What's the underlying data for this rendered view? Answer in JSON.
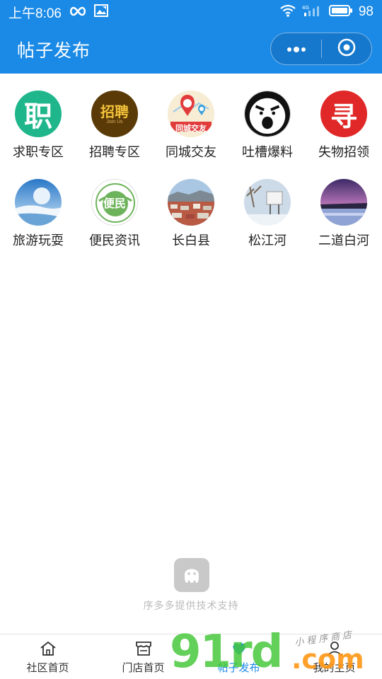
{
  "status_bar": {
    "time": "上午8:06",
    "battery": "98",
    "icons": [
      "infinity-icon",
      "image-notification-icon",
      "wifi-icon",
      "signal-4g-icon",
      "battery-icon"
    ]
  },
  "header": {
    "title": "帖子发布",
    "capsule_icons": [
      "more-dots-icon",
      "close-target-icon"
    ]
  },
  "colors": {
    "header_bg": "#1a8ae6",
    "accent": "#1a8ae6"
  },
  "categories": [
    {
      "label": "求职专区",
      "icon": "job-seek-icon",
      "glyph": "职"
    },
    {
      "label": "招聘专区",
      "icon": "recruit-icon",
      "glyph": "招聘",
      "sub": "Join Us"
    },
    {
      "label": "同城交友",
      "icon": "city-friends-icon",
      "glyph": "同城交友"
    },
    {
      "label": "吐槽爆料",
      "icon": "complain-face-icon"
    },
    {
      "label": "失物招领",
      "icon": "lost-found-icon",
      "glyph": "寻"
    },
    {
      "label": "旅游玩耍",
      "icon": "travel-photo-icon"
    },
    {
      "label": "便民资讯",
      "icon": "convenience-info-icon",
      "glyph": "便民"
    },
    {
      "label": "长白县",
      "icon": "changbai-county-photo-icon"
    },
    {
      "label": "松江河",
      "icon": "songjianghe-photo-icon"
    },
    {
      "label": "二道白河",
      "icon": "erdaobaihe-photo-icon"
    }
  ],
  "support": {
    "text": "序多多提供技术支持",
    "icon": "octopus-logo-icon"
  },
  "tabs": [
    {
      "label": "社区首页",
      "icon": "home-icon"
    },
    {
      "label": "门店首页",
      "icon": "store-icon"
    },
    {
      "label": "帖子发布",
      "icon": "post-publish-icon"
    },
    {
      "label": "我的主页",
      "icon": "user-profile-icon"
    }
  ],
  "watermark": {
    "big": "91rd",
    "com": ".com",
    "small": "小程序商店"
  }
}
